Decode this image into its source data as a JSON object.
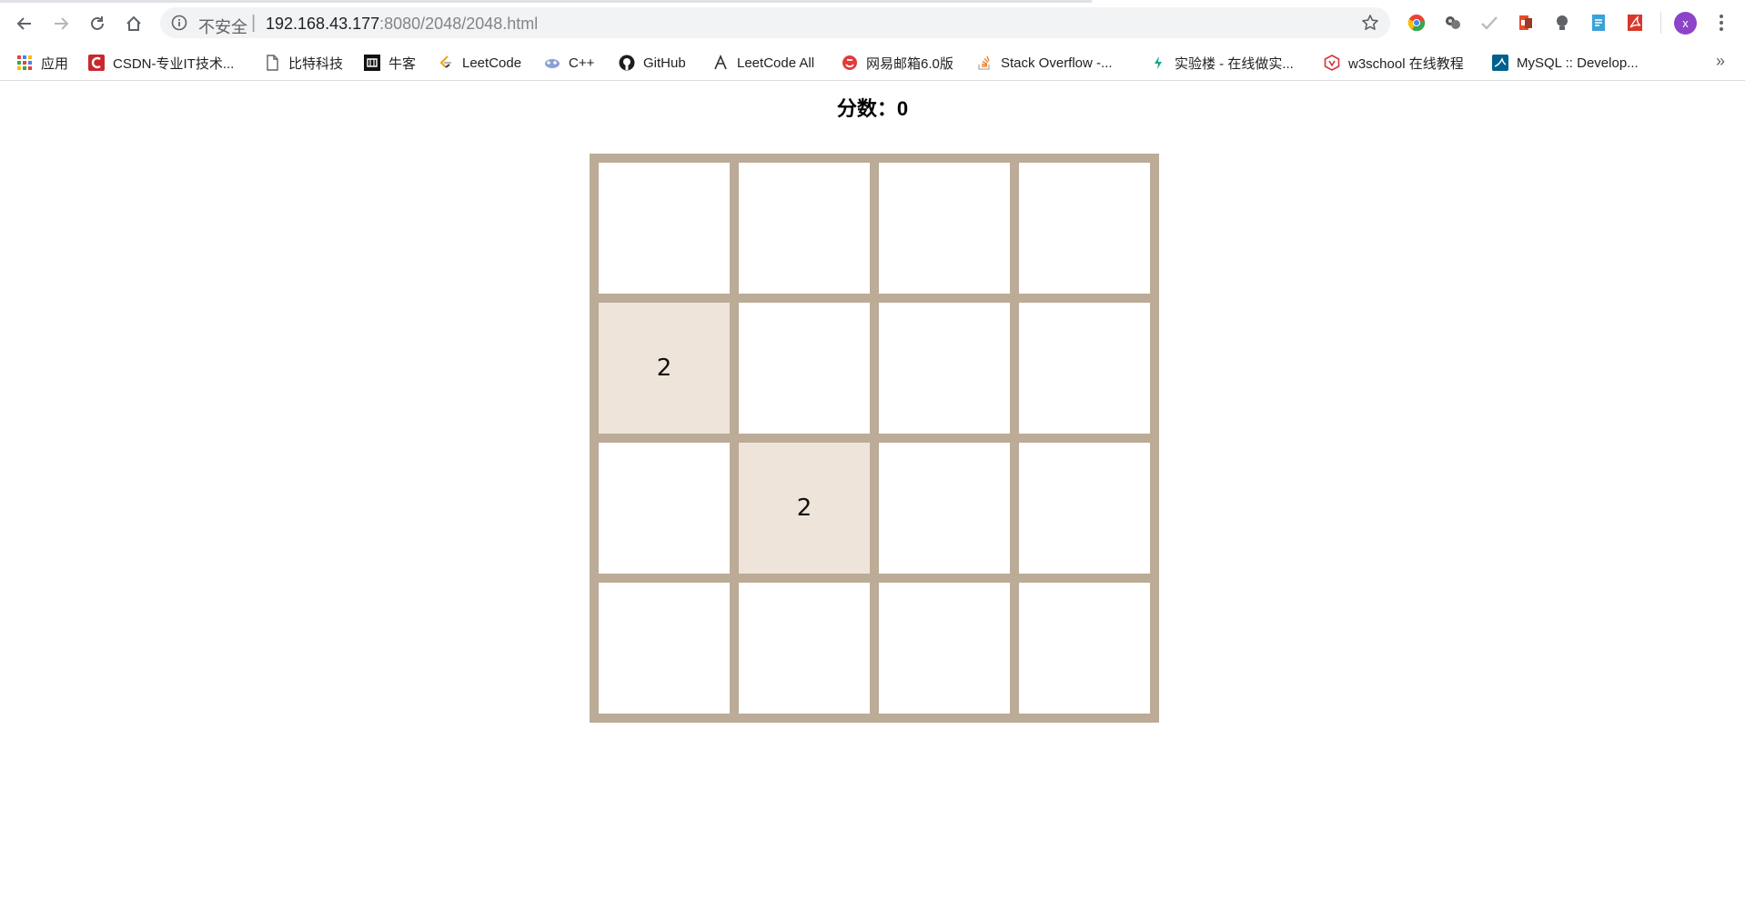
{
  "browser": {
    "security_label": "不安全",
    "url_host": "192.168.43.177",
    "url_path": ":8080/2048/2048.html",
    "profile_initial": "x"
  },
  "bookmarks": [
    {
      "label": "应用",
      "icon": "apps-grid-icon"
    },
    {
      "label": "CSDN-专业IT技术...",
      "icon": "csdn-icon"
    },
    {
      "label": "比特科技",
      "icon": "page-icon"
    },
    {
      "label": "牛客",
      "icon": "nowcoder-icon"
    },
    {
      "label": "LeetCode",
      "icon": "leetcode-icon"
    },
    {
      "label": "C++",
      "icon": "cplusplus-icon"
    },
    {
      "label": "GitHub",
      "icon": "github-icon"
    },
    {
      "label": "LeetCode All",
      "icon": "leetcode-all-icon"
    },
    {
      "label": "网易邮箱6.0版",
      "icon": "netease-mail-icon"
    },
    {
      "label": "Stack Overflow -...",
      "icon": "stackoverflow-icon"
    },
    {
      "label": "实验楼 - 在线做实...",
      "icon": "shiyanlou-icon"
    },
    {
      "label": "w3school 在线教程",
      "icon": "w3school-icon"
    },
    {
      "label": "MySQL :: Develop...",
      "icon": "mysql-icon"
    }
  ],
  "game": {
    "score_label": "分数：",
    "score_value": "0",
    "grid": [
      [
        "",
        "",
        "",
        ""
      ],
      [
        "2",
        "",
        "",
        ""
      ],
      [
        "",
        "2",
        "",
        ""
      ],
      [
        "",
        "",
        "",
        ""
      ]
    ],
    "colors": {
      "board": "#bbab97",
      "empty_cell": "#ffffff",
      "tile_2": "#eee4da"
    }
  }
}
